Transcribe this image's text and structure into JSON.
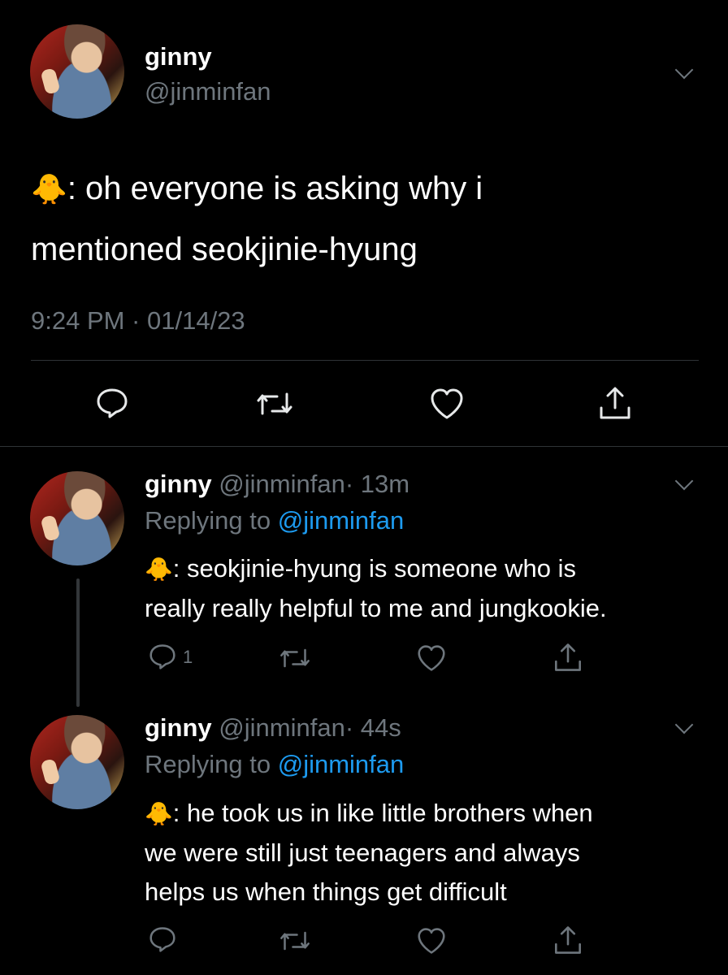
{
  "main_tweet": {
    "display_name": "ginny",
    "handle": "@jinminfan",
    "emoji": "🐥",
    "text_line1": ": oh everyone is asking why i",
    "text_line2": "mentioned seokjinie-hyung",
    "timestamp": "9:24 PM · 01/14/23"
  },
  "replies": [
    {
      "display_name": "ginny",
      "handle": "@jinminfan",
      "age": "· 13m",
      "replying_label": "Replying to",
      "replying_to": "@jinminfan",
      "emoji": "🐥",
      "line1": ": seokjinie-hyung is someone who is",
      "line2": "really really helpful to me and jungkookie.",
      "reply_count": "1"
    },
    {
      "display_name": "ginny",
      "handle": "@jinminfan",
      "age": "· 44s",
      "replying_label": "Replying to",
      "replying_to": "@jinminfan",
      "emoji": "🐥",
      "line1": ": he took us in like little brothers when",
      "line2": "we were still just teenagers and always",
      "line3": "helps us when things get difficult"
    }
  ],
  "icons": [
    "reply-icon",
    "retweet-icon",
    "like-icon",
    "share-icon",
    "chevron-down-icon"
  ],
  "colors": {
    "background": "#000000",
    "text": "#ffffff",
    "muted": "#6e767d",
    "link": "#1d9bf0"
  }
}
